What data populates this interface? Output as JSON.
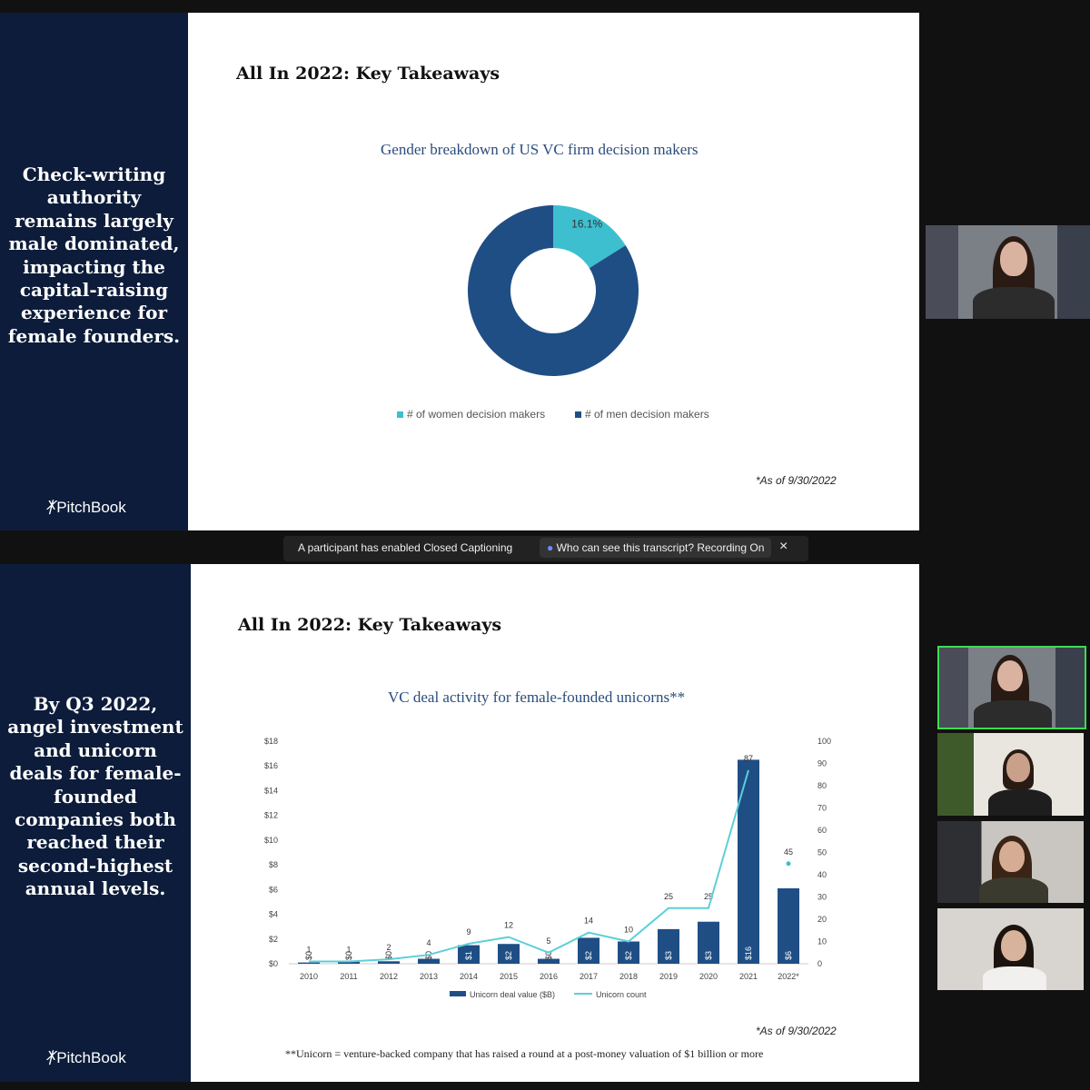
{
  "slide1": {
    "side_text": "Check-writing authority remains largely male dominated, impacting the capital-raising experience for female founders.",
    "logo": "PitchBook",
    "title": "All In 2022: Key Takeaways",
    "chart_title": "Gender breakdown of US VC firm decision makers",
    "note": "*As of 9/30/2022"
  },
  "slide2": {
    "side_text": "By Q3 2022, angel investment and unicorn deals for female-founded companies both reached their second-highest annual levels.",
    "logo": "PitchBook",
    "title": "All In 2022: Key Takeaways",
    "chart_title": "VC deal activity for female-founded unicorns**",
    "note": "*As of 9/30/2022",
    "footnote": "**Unicorn = venture-backed company that has raised a round at a post-money valuation of $1 billion or more"
  },
  "caption_bar": {
    "message": "A participant has enabled Closed Captioning",
    "transcript": "Who can see this transcript? Recording On",
    "close": "×"
  },
  "colors": {
    "navy": "#0c1c3a",
    "women": "#3dbfcf",
    "men": "#1f4e85",
    "line": "#5ccfd9"
  },
  "chart_data": [
    {
      "type": "pie",
      "title": "Gender breakdown of US VC firm decision makers",
      "labels": [
        "# of women decision makers",
        "# of men decision makers"
      ],
      "values": [
        16.1,
        83.9
      ],
      "value_labels": [
        "16.1%",
        "83.9%"
      ],
      "colors": [
        "#3dbfcf",
        "#1f4e85"
      ],
      "legend": "bottom"
    },
    {
      "type": "bar",
      "title": "VC deal activity for female-founded unicorns**",
      "categories": [
        "2010",
        "2011",
        "2012",
        "2013",
        "2014",
        "2015",
        "2016",
        "2017",
        "2018",
        "2019",
        "2020",
        "2021",
        "2022*"
      ],
      "series": [
        {
          "name": "Unicorn deal value ($B)",
          "type": "bar",
          "axis": "left",
          "values": [
            0.1,
            0.2,
            0.2,
            0.4,
            1.5,
            1.6,
            0.4,
            2.1,
            1.8,
            2.8,
            3.4,
            16.5,
            6.1
          ],
          "labels": [
            "$0",
            "$0",
            "$0",
            "$0",
            "$1",
            "$2",
            "$0",
            "$2",
            "$2",
            "$3",
            "$3",
            "$16",
            "$6"
          ]
        },
        {
          "name": "Unicorn count",
          "type": "line",
          "axis": "right",
          "values": [
            1,
            1,
            2,
            4,
            9,
            12,
            5,
            14,
            10,
            25,
            25,
            87,
            45
          ]
        }
      ],
      "y_left": {
        "ticks": [
          "$0",
          "$2",
          "$4",
          "$6",
          "$8",
          "$10",
          "$12",
          "$14",
          "$16",
          "$18"
        ],
        "range": [
          0,
          18
        ]
      },
      "y_right": {
        "ticks": [
          "0",
          "10",
          "20",
          "30",
          "40",
          "50",
          "60",
          "70",
          "80",
          "90",
          "100"
        ],
        "range": [
          0,
          100
        ]
      },
      "legend": "bottom"
    }
  ]
}
